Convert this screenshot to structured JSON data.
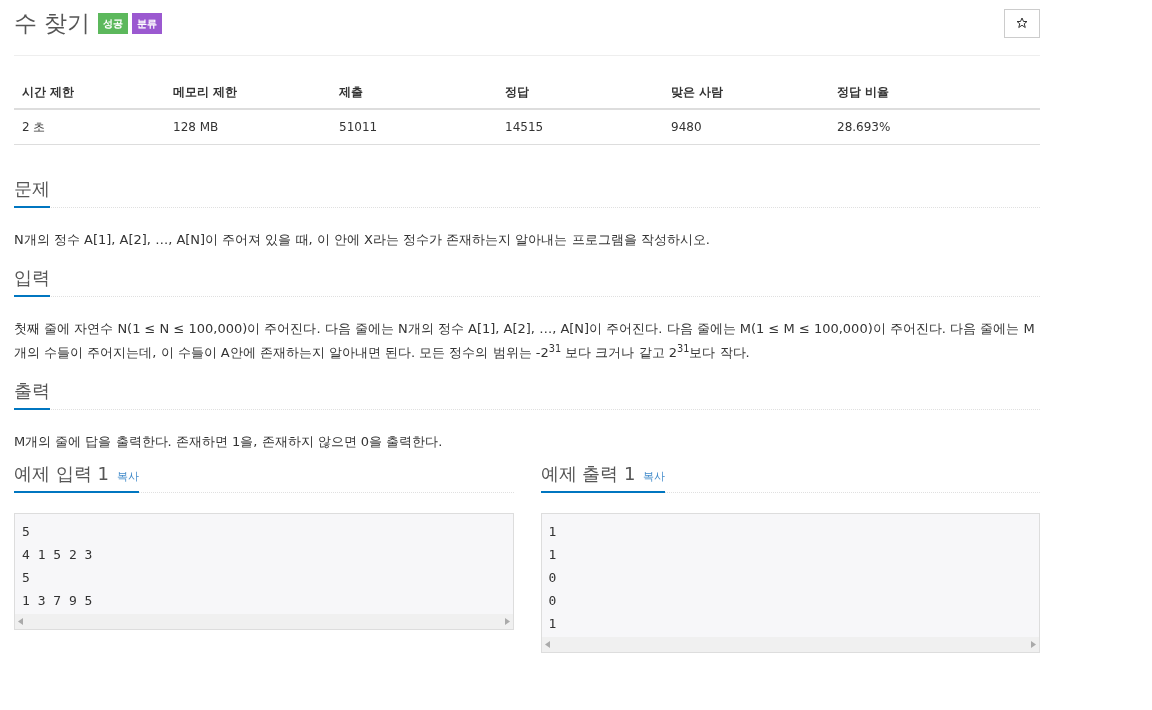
{
  "title": "수 찾기",
  "badges": [
    {
      "label": "성공",
      "color": "#5cb85c"
    },
    {
      "label": "분류",
      "color": "#9b59d0"
    }
  ],
  "info_table": {
    "columns": [
      "시간 제한",
      "메모리 제한",
      "제출",
      "정답",
      "맞은 사람",
      "정답 비율"
    ],
    "rows": [
      [
        "2 초",
        "128 MB",
        "51011",
        "14515",
        "9480",
        "28.693%"
      ]
    ]
  },
  "sections": [
    {
      "heading": "문제",
      "text": "N개의 정수 A[1], A[2], …, A[N]이 주어져 있을 때, 이 안에 X라는 정수가 존재하는지 알아내는 프로그램을 작성하시오."
    },
    {
      "heading": "입력",
      "text": "첫째 줄에 자연수 N(1 ≤ N ≤ 100,000)이 주어진다. 다음 줄에는 N개의 정수 A[1], A[2], …, A[N]이 주어진다. 다음 줄에는 M(1 ≤ M ≤ 100,000)이 주어진다. 다음 줄에는 M개의 수들이 주어지는데, 이 수들이 A안에 존재하는지 알아내면 된다. 모든 정수의 범위는 -2$^{31}$ 보다 크거나 같고 2$^{31}$보다 작다."
    },
    {
      "heading": "출력",
      "text": "M개의 줄에 답을 출력한다. 존재하면 1을, 존재하지 않으면 0을 출력한다."
    }
  ],
  "samples": [
    {
      "heading": "예제 입력 1",
      "copy": "복사",
      "lines": [
        "5",
        "4 1 5 2 3",
        "5",
        "1 3 7 9 5"
      ]
    },
    {
      "heading": "예제 출력 1",
      "copy": "복사",
      "lines": [
        "1",
        "1",
        "0",
        "0",
        "1"
      ]
    }
  ]
}
